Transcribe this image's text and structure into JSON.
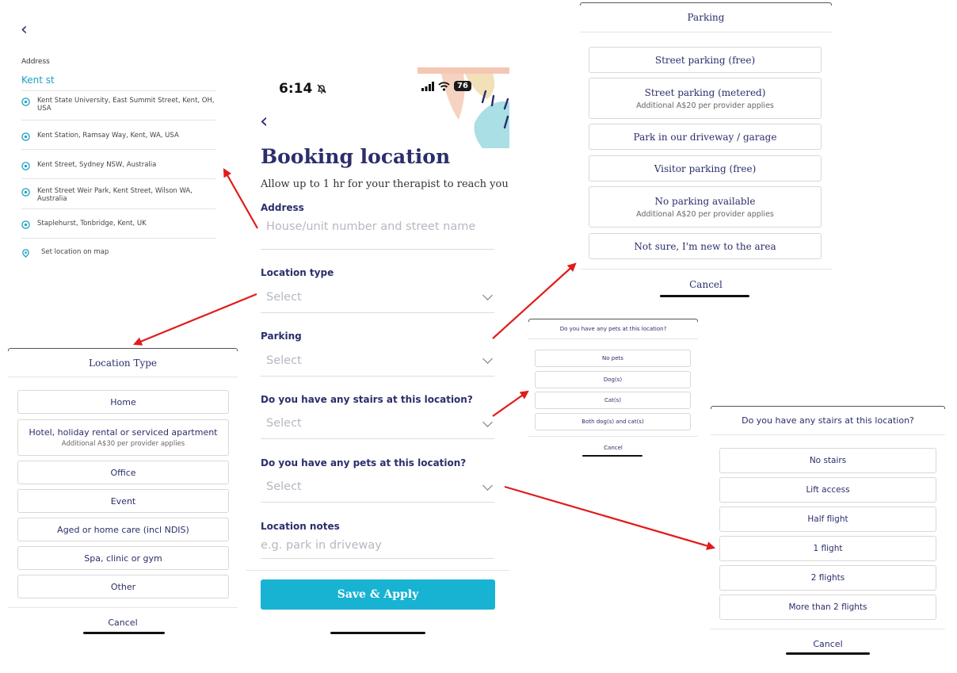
{
  "colors": {
    "accent": "#18b2d3",
    "brand": "#2b2e6b",
    "arrow": "#e21b1b"
  },
  "address_panel": {
    "label": "Address",
    "value": "Kent st",
    "suggestions": [
      "Kent State University, East Summit Street, Kent, OH, USA",
      "Kent Station, Ramsay Way, Kent, WA, USA",
      "Kent Street, Sydney NSW, Australia",
      "Kent Street Weir Park, Kent Street, Wilson WA, Australia",
      "Staplehurst, Tonbridge, Kent, UK"
    ],
    "map_option": "Set location on map"
  },
  "location_type_sheet": {
    "title": "Location Type",
    "options": [
      {
        "label": "Home",
        "note": ""
      },
      {
        "label": "Hotel, holiday rental or serviced apartment",
        "note": "Additional A$30 per provider applies"
      },
      {
        "label": "Office",
        "note": ""
      },
      {
        "label": "Event",
        "note": ""
      },
      {
        "label": "Aged or home care (incl NDIS)",
        "note": ""
      },
      {
        "label": "Spa, clinic or gym",
        "note": ""
      },
      {
        "label": "Other",
        "note": ""
      }
    ],
    "cancel": "Cancel"
  },
  "phone": {
    "status": {
      "time": "6:14",
      "battery": "76"
    },
    "title": "Booking location",
    "subtitle": "Allow up to 1 hr for your therapist to reach you",
    "fields": {
      "address": {
        "label": "Address",
        "placeholder": "House/unit number and street name"
      },
      "location_type": {
        "label": "Location type",
        "placeholder": "Select"
      },
      "parking": {
        "label": "Parking",
        "placeholder": "Select"
      },
      "stairs": {
        "label": "Do you have any stairs at this location?",
        "placeholder": "Select"
      },
      "pets": {
        "label": "Do you have any pets at this location?",
        "placeholder": "Select"
      },
      "notes": {
        "label": "Location notes",
        "placeholder": "e.g. park in driveway"
      }
    },
    "save_button": "Save & Apply"
  },
  "parking_sheet": {
    "title": "Parking",
    "options": [
      {
        "label": "Street parking (free)",
        "note": ""
      },
      {
        "label": "Street parking (metered)",
        "note": "Additional A$20 per provider applies"
      },
      {
        "label": "Park in our driveway / garage",
        "note": ""
      },
      {
        "label": "Visitor parking (free)",
        "note": ""
      },
      {
        "label": "No parking available",
        "note": "Additional A$20 per provider applies"
      },
      {
        "label": "Not sure, I'm new to the area",
        "note": ""
      }
    ],
    "cancel": "Cancel"
  },
  "pets_sheet": {
    "title": "Do you have any pets at this location?",
    "options": [
      "No pets",
      "Dog(s)",
      "Cat(s)",
      "Both dog(s) and cat(s)"
    ],
    "cancel": "Cancel"
  },
  "stairs_sheet": {
    "title": "Do you have any stairs at this location?",
    "options": [
      "No stairs",
      "Lift access",
      "Half flight",
      "1 flight",
      "2 flights",
      "More than 2 flights"
    ],
    "cancel": "Cancel"
  }
}
